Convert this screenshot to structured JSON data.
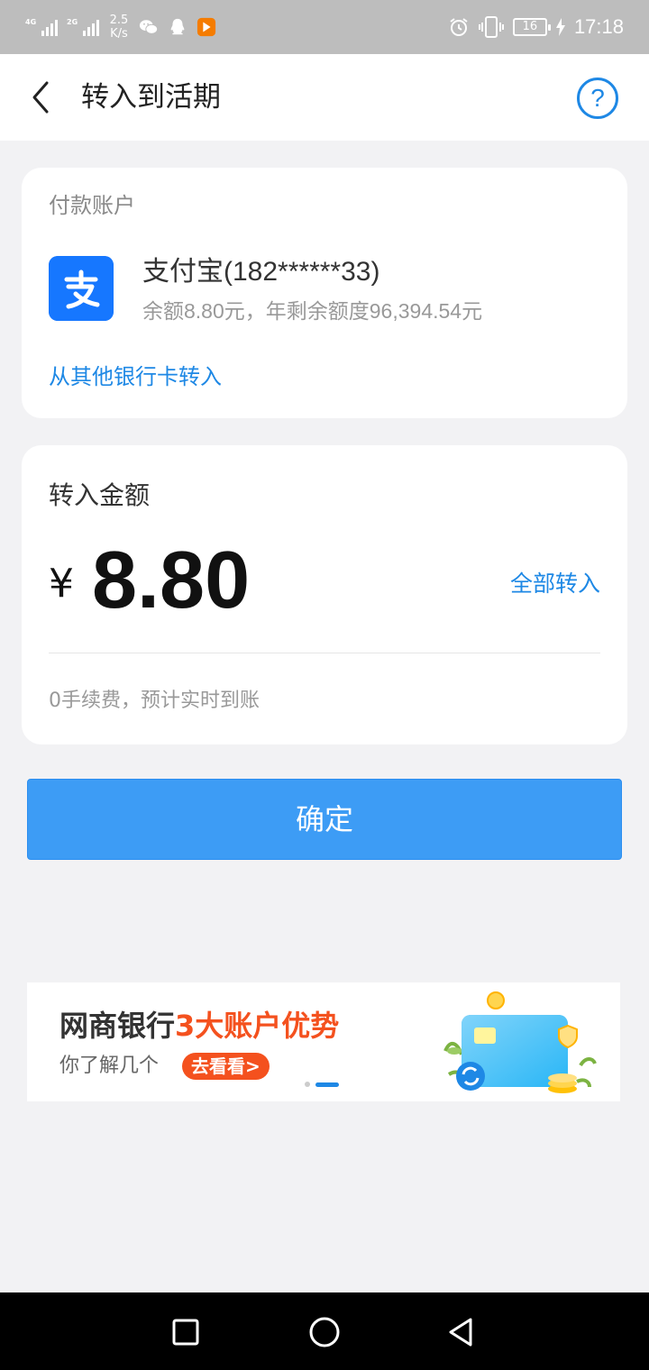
{
  "status_bar": {
    "signal1": "4G",
    "signal2": "2G",
    "speed_value": "2.5",
    "speed_unit": "K/s",
    "battery": "16",
    "time": "17:18"
  },
  "header": {
    "title": "转入到活期",
    "help": "?"
  },
  "pay_card": {
    "label": "付款账户",
    "account_name": "支付宝(182******33)",
    "balance_line": "余额8.80元，年剩余额度96,394.54元",
    "other_bank": "从其他银行卡转入"
  },
  "amount_card": {
    "label": "转入金额",
    "currency": "¥",
    "amount_value": "8.80",
    "transfer_all": "全部转入",
    "fee_note": "0手续费，预计实时到账"
  },
  "confirm": {
    "label": "确定"
  },
  "banner": {
    "title_pre": "网商银行",
    "title_highlight": "3大账户优势",
    "subtitle": "你了解几个",
    "cta": "去看看>",
    "active_dot": 2
  },
  "colors": {
    "accent": "#1e88e5",
    "button": "#3d9cf5",
    "alipay": "#1677ff",
    "promo": "#f4511e"
  },
  "icons": {
    "back": "chevron-left-icon",
    "help": "question-circle-icon",
    "alipay": "alipay-logo",
    "nav_recent": "square-icon",
    "nav_home": "circle-icon",
    "nav_back": "triangle-back-icon"
  }
}
